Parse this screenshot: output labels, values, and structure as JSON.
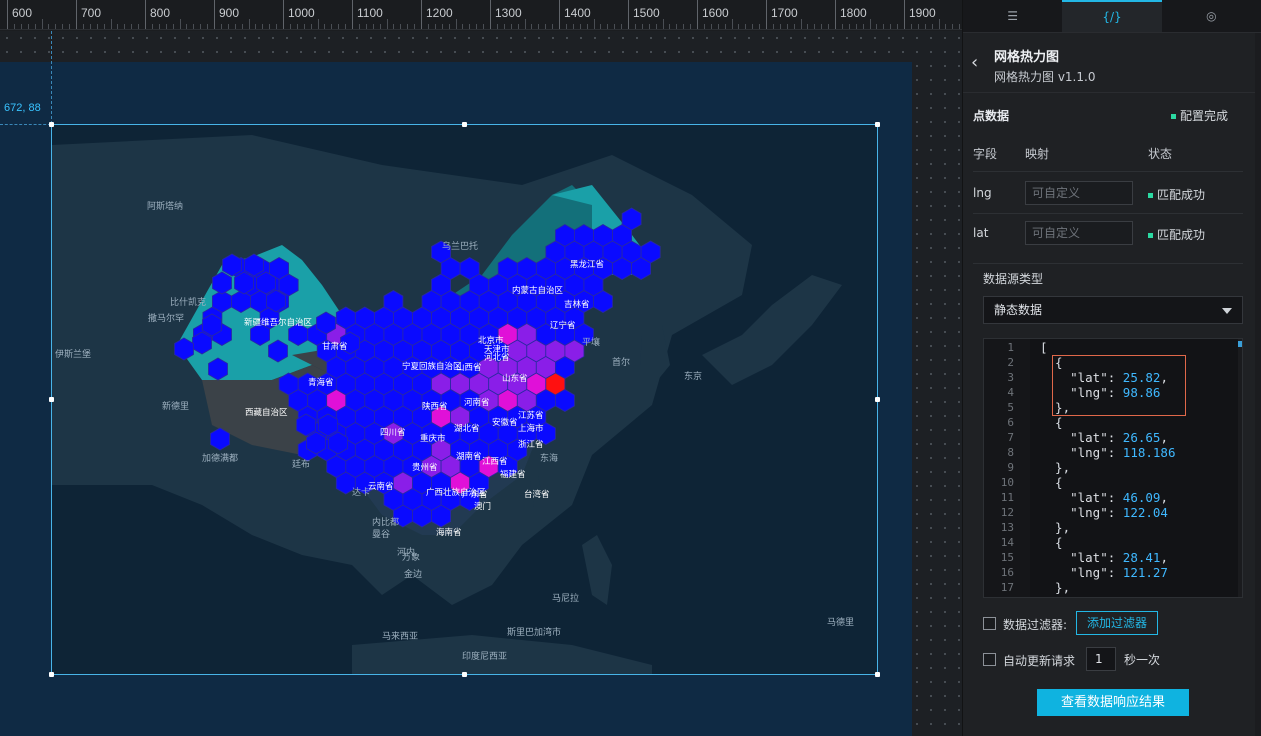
{
  "ruler": {
    "labels": [
      "600",
      "700",
      "800",
      "900",
      "1000",
      "1100",
      "1200",
      "1300",
      "1400",
      "1500",
      "1600",
      "1700",
      "1800",
      "1900"
    ]
  },
  "canvas": {
    "coord_readout": "672, 88"
  },
  "map": {
    "colors": {
      "ocean": "#0e2436",
      "land": "#1f3a4c",
      "teal": "#1aa0a8",
      "dark": "#3b4248",
      "blue": "#0a0aff",
      "violet": "#8a1ee8",
      "magenta": "#e010d8",
      "red": "#ff1010"
    },
    "foreign_labels": [
      "阿斯塔纳",
      "乌兰巴托",
      "比什凯克",
      "撒马尔罕",
      "伊斯兰堡",
      "新德里",
      "加德满都",
      "廷布",
      "达卡",
      "内比都",
      "曼谷",
      "马尼拉",
      "河内",
      "万象",
      "金边",
      "马来西亚",
      "斯里巴加湾市",
      "印度尼西亚",
      "东京",
      "首尔",
      "平壤",
      "东海",
      "马德里"
    ],
    "province_labels": [
      "黑龙江省",
      "吉林省",
      "内蒙古自治区",
      "辽宁省",
      "北京市",
      "天津市",
      "河北省",
      "山西省",
      "山东省",
      "宁夏回族自治区",
      "甘肃省",
      "青海省",
      "新疆维吾尔自治区",
      "西藏自治区",
      "陕西省",
      "河南省",
      "江苏省",
      "安徽省",
      "上海市",
      "湖北省",
      "四川省",
      "重庆市",
      "浙江省",
      "湖南省",
      "江西省",
      "贵州省",
      "福建省",
      "台湾省",
      "云南省",
      "广西壮族自治区",
      "广东省",
      "澳门",
      "海南省"
    ]
  },
  "panel": {
    "tabs": [
      {
        "icon": "sliders-icon",
        "label": "☰"
      },
      {
        "icon": "code-icon",
        "label": "{/}"
      },
      {
        "icon": "interaction-icon",
        "label": "◎"
      }
    ],
    "back_icon": "chevron-left-icon",
    "title": "网格热力图",
    "subtitle": "网格热力图 v1.1.0",
    "section_label": "点数据",
    "section_status": "配置完成",
    "columns": {
      "field": "字段",
      "mapping": "映射",
      "status": "状态"
    },
    "fields": [
      {
        "name": "lng",
        "placeholder": "可自定义",
        "status": "匹配成功"
      },
      {
        "name": "lat",
        "placeholder": "可自定义",
        "status": "匹配成功"
      }
    ],
    "datasource_label": "数据源类型",
    "datasource_value": "静态数据",
    "code_lines": [
      {
        "no": "1",
        "text": "["
      },
      {
        "no": "2",
        "text": "  {"
      },
      {
        "no": "3",
        "key": "    \"lat\": ",
        "val": "25.82",
        "tail": ","
      },
      {
        "no": "4",
        "key": "    \"lng\": ",
        "val": "98.86",
        "tail": ""
      },
      {
        "no": "5",
        "text": "  },"
      },
      {
        "no": "6",
        "text": "  {"
      },
      {
        "no": "7",
        "key": "    \"lat\": ",
        "val": "26.65",
        "tail": ","
      },
      {
        "no": "8",
        "key": "    \"lng\": ",
        "val": "118.186",
        "tail": ""
      },
      {
        "no": "9",
        "text": "  },"
      },
      {
        "no": "10",
        "text": "  {"
      },
      {
        "no": "11",
        "key": "    \"lat\": ",
        "val": "46.09",
        "tail": ","
      },
      {
        "no": "12",
        "key": "    \"lng\": ",
        "val": "122.04",
        "tail": ""
      },
      {
        "no": "13",
        "text": "  },"
      },
      {
        "no": "14",
        "text": "  {"
      },
      {
        "no": "15",
        "key": "    \"lat\": ",
        "val": "28.41",
        "tail": ","
      },
      {
        "no": "16",
        "key": "    \"lng\": ",
        "val": "121.27",
        "tail": ""
      },
      {
        "no": "17",
        "text": "  },"
      }
    ],
    "filter_label": "数据过滤器:",
    "filter_button": "添加过滤器",
    "auto_update_label": "自动更新请求",
    "auto_update_value": "1",
    "auto_update_unit": "秒一次",
    "view_result_button": "查看数据响应结果"
  }
}
